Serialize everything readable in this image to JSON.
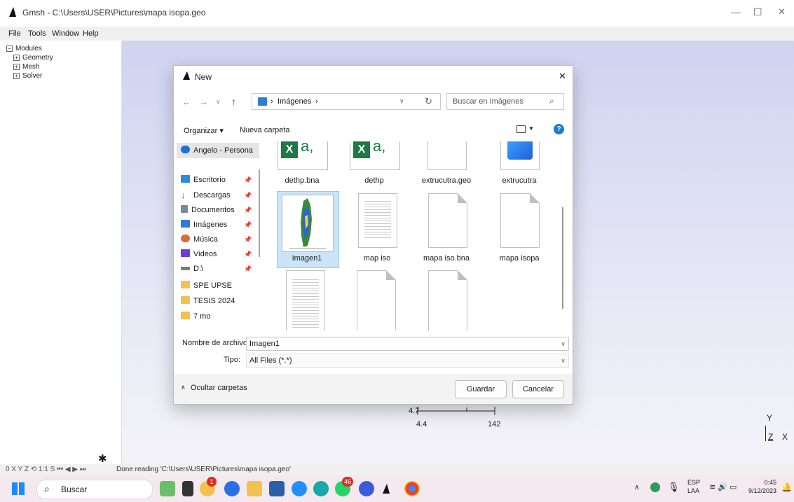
{
  "app": {
    "title": "Gmsh - C:\\Users\\USER\\Pictures\\mapa isopa.geo",
    "menu": [
      "File",
      "Tools",
      "Window",
      "Help"
    ],
    "tree": [
      {
        "label": "Modules",
        "toggle": "−"
      },
      {
        "label": "Geometry",
        "toggle": "+"
      },
      {
        "label": "Mesh",
        "toggle": "+"
      },
      {
        "label": "Solver",
        "toggle": "+"
      }
    ],
    "window_controls": {
      "minimize": "—",
      "maximize": "☐",
      "close": "✕"
    }
  },
  "viewport": {
    "axis_values": {
      "y_tick": "4.7",
      "x_min": "4.4",
      "x_max": "142"
    },
    "corner_axes": {
      "y": "Y",
      "z": "Z",
      "x": "X"
    }
  },
  "status": {
    "icons": "0 X Y Z ⟲ 1:1 S ⏮ ◀ ▶ ⏭",
    "message": "Done reading 'C:\\Users\\USER\\Pictures\\mapa isopa.geo'"
  },
  "dialog": {
    "title": "New",
    "path": {
      "folder": "Imágenes",
      "separator": "›"
    },
    "search_placeholder": "Buscar en Imágenes",
    "commands": {
      "organize": "Organizar ▾",
      "new_folder": "Nueva carpeta"
    },
    "nav": [
      {
        "label": "Angelo - Persona",
        "color": "#1f6fd6",
        "pinned": false
      },
      {
        "label": "Escritorio",
        "color": "#2d8bd9",
        "pinned": true
      },
      {
        "label": "Descargas",
        "color": "#2a8a3a",
        "pinned": true
      },
      {
        "label": "Documentos",
        "color": "#7d8894",
        "pinned": true
      },
      {
        "label": "Imágenes",
        "color": "#2f7bd8",
        "pinned": true
      },
      {
        "label": "Música",
        "color": "#e06a3a",
        "pinned": true
      },
      {
        "label": "Videos",
        "color": "#6a3fd1",
        "pinned": true
      },
      {
        "label": "D:\\",
        "color": "#7a7a7a",
        "pinned": true
      },
      {
        "label": "SPE UPSE",
        "color": "#f2c14e",
        "pinned": false
      },
      {
        "label": "TESIS 2024",
        "color": "#f2c14e",
        "pinned": false
      },
      {
        "label": "7 mo",
        "color": "#f2c14e",
        "pinned": false
      }
    ],
    "files": [
      {
        "name": "dethp.bna",
        "kind": "excel"
      },
      {
        "name": "dethp",
        "kind": "excel"
      },
      {
        "name": "extrucutra.geo",
        "kind": "doc"
      },
      {
        "name": "extrucutra",
        "kind": "app"
      },
      {
        "name": "Imagen1",
        "kind": "image",
        "selected": true
      },
      {
        "name": "map iso",
        "kind": "lined"
      },
      {
        "name": "mapa iso.bna",
        "kind": "doc"
      },
      {
        "name": "mapa isopa",
        "kind": "doc"
      },
      {
        "name": "",
        "kind": "lined"
      },
      {
        "name": "",
        "kind": "doc"
      },
      {
        "name": "",
        "kind": "doc"
      }
    ],
    "filename_label": "Nombre de archivo:",
    "filename_value": "Imagen1",
    "type_label": "Tipo:",
    "type_value": "All Files (*.*)",
    "hide_folders": "Ocultar carpetas",
    "save": "Guardar",
    "cancel": "Cancelar"
  },
  "taskbar": {
    "search": "Buscar",
    "badges": {
      "notifications": "1",
      "whatsapp": "46"
    },
    "tray": {
      "lang1": "ESP",
      "lang2": "LAA",
      "time": "0:45",
      "date": "9/12/2023"
    }
  }
}
